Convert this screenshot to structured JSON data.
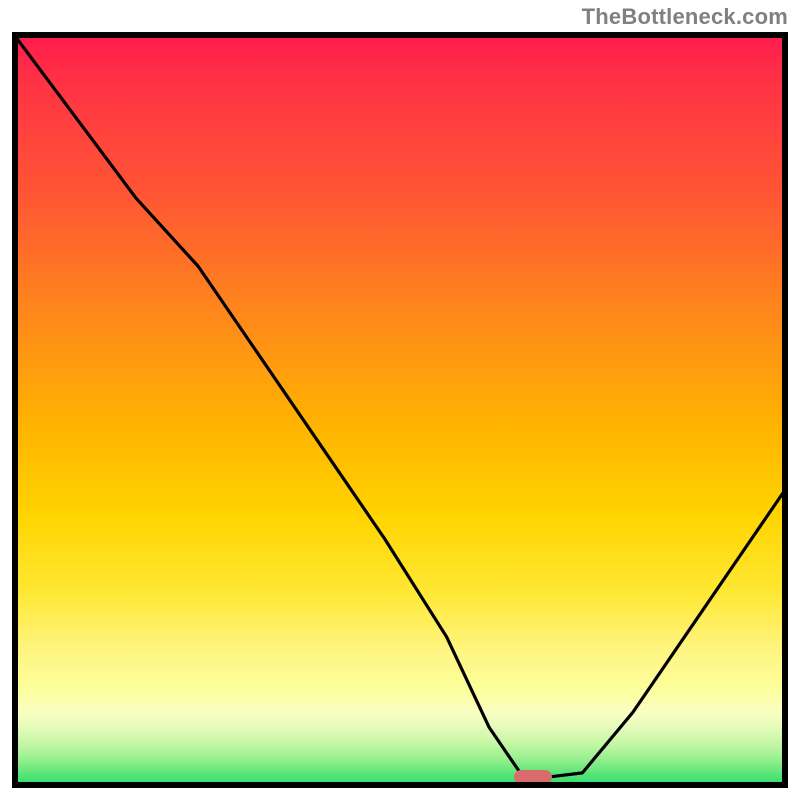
{
  "watermark": "TheBottleneck.com",
  "marker": {
    "x_frac": 0.672,
    "y_frac": 0.985
  },
  "chart_data": {
    "type": "line",
    "title": "",
    "xlabel": "",
    "ylabel": "",
    "xlim": [
      0,
      1
    ],
    "ylim": [
      0,
      1
    ],
    "series": [
      {
        "name": "bottleneck-curve",
        "x": [
          0.0,
          0.08,
          0.16,
          0.24,
          0.32,
          0.4,
          0.48,
          0.56,
          0.615,
          0.655,
          0.695,
          0.735,
          0.8,
          0.88,
          0.94,
          1.0
        ],
        "y": [
          1.0,
          0.89,
          0.78,
          0.69,
          0.57,
          0.45,
          0.33,
          0.2,
          0.08,
          0.02,
          0.015,
          0.02,
          0.1,
          0.22,
          0.31,
          0.4
        ]
      }
    ],
    "annotations": [
      {
        "type": "marker",
        "shape": "pill",
        "color": "#d96b6b",
        "x": 0.672,
        "y": 0.015
      }
    ],
    "background_gradient": {
      "direction": "vertical",
      "stops": [
        {
          "pos": 0.0,
          "color": "#ff1a4d"
        },
        {
          "pos": 0.5,
          "color": "#ffb300"
        },
        {
          "pos": 0.85,
          "color": "#fff583"
        },
        {
          "pos": 1.0,
          "color": "#21da6f"
        }
      ]
    }
  }
}
